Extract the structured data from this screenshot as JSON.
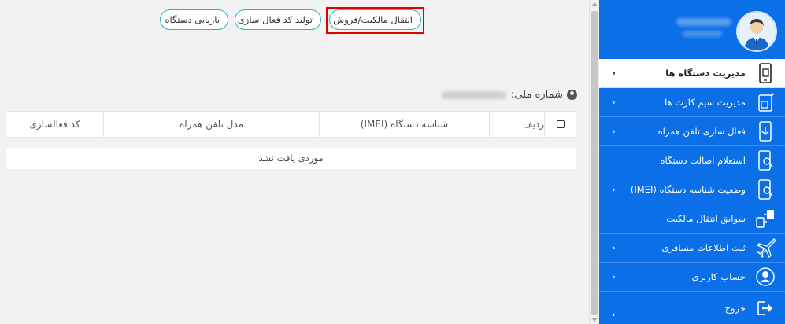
{
  "toolbar": {
    "transfer_label": "انتقال مالکیت/فروش",
    "activation_code_label": "تولید کد فعال سازی",
    "device_recovery_label": "بازیابی دستگاه"
  },
  "national_id": {
    "label": "شماره ملی:"
  },
  "table": {
    "columns": [
      "ردیف",
      "شناسه دستگاه (IMEI)",
      "مدل تلفن همراه",
      "کد فعالسازی"
    ],
    "empty_message": "موردی یافت نشد"
  },
  "sidebar": {
    "items": [
      {
        "label": "مدیریت دستگاه ها",
        "icon": "phone-sim-icon",
        "active": true
      },
      {
        "label": "مدیریت سیم کارت ها",
        "icon": "sim-card-icon"
      },
      {
        "label": "فعال سازی تلفن همراه",
        "icon": "phone-download-icon"
      },
      {
        "label": "استعلام اصالت دستگاه",
        "icon": "phone-search-icon"
      },
      {
        "label": "وضعیت شناسه دستگاه (IMEI)",
        "icon": "phone-search-icon"
      },
      {
        "label": "سوابق انتقال مالکیت",
        "icon": "transfer-icon"
      },
      {
        "label": "ثبت اطلاعات مسافری",
        "icon": "airplane-icon"
      },
      {
        "label": "حساب کاربری",
        "icon": "user-circle-icon"
      },
      {
        "label": "خروج",
        "icon": "logout-icon"
      }
    ]
  },
  "colors": {
    "sidebar_bg": "#0b6fe8",
    "pill_border": "#29b3c6",
    "highlight": "#e00000"
  }
}
